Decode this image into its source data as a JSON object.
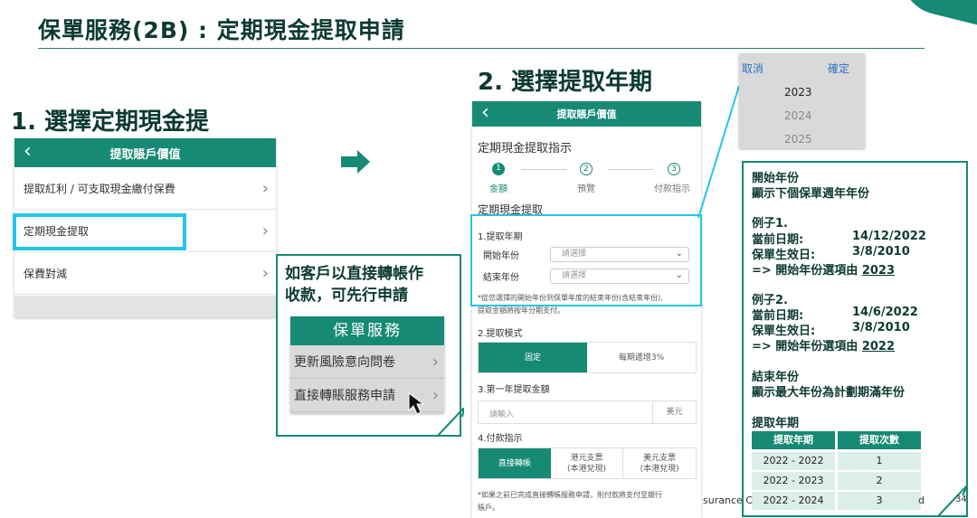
{
  "page": {
    "title": "保單服務(2B) : 定期現金提取申請",
    "page_number": "34",
    "footer_left": "surance C",
    "footer_right": "d"
  },
  "section1": {
    "title": "1. 選擇定期現金提"
  },
  "section2": {
    "title": "2. 選擇提取年期"
  },
  "panel1": {
    "header": "提取賬戶價值",
    "items": [
      {
        "label": "提取紅利 / 可支取現金繳付保費"
      },
      {
        "label": "定期現金提取"
      },
      {
        "label": "保費對減"
      }
    ]
  },
  "callout": {
    "text_line1": "如客戶以直接轉帳作",
    "text_line2": "收款，可先行申請",
    "mini_header": "保單服務",
    "mini_items": [
      {
        "label": "更新風險意向問卷"
      },
      {
        "label": "直接轉賬服務申請"
      }
    ]
  },
  "panel2": {
    "header": "提取賬戶價值",
    "section_title": "定期現金提取指示",
    "steps": [
      {
        "num": "1",
        "label": "金額"
      },
      {
        "num": "2",
        "label": "預覽"
      },
      {
        "num": "3",
        "label": "付款指示"
      }
    ],
    "subsection": "定期現金提取",
    "q1": "1.提取年期",
    "start_label": "開始年份",
    "end_label": "結束年份",
    "select_placeholder": "請選擇",
    "note1": "*從您選擇的開始年份到保單年度的結束年份(含結束年份),",
    "note2": "提取金額將按年分期支付。",
    "q2": "2.提取模式",
    "mode_options": [
      "固定",
      "每期遞增3%"
    ],
    "q3": "3.第一年提取金額",
    "amount_placeholder": "請輸入",
    "currency": "美元",
    "q4": "4.付款指示",
    "pay_options": [
      {
        "l1": "直接轉帳",
        "l2": ""
      },
      {
        "l1": "港元支票",
        "l2": "(本港兌現)"
      },
      {
        "l1": "美元支票",
        "l2": "(本港兌現)"
      }
    ],
    "note3": "*如果之前已完成直接轉賬服務申請，則付款將支付至銀行",
    "note4": "賬戶。"
  },
  "picker": {
    "cancel": "取消",
    "confirm": "確定",
    "years": [
      "2023",
      "2024",
      "2025"
    ]
  },
  "info": {
    "start_title": "開始年份",
    "start_desc": "顯示下個保單週年年份",
    "ex1_title": "例子1.",
    "ex1_date_label": "當前日期:",
    "ex1_date": "14/12/2022",
    "ex1_eff_label": "保單生效日:",
    "ex1_eff": "3/8/2010",
    "ex1_result": "=> 開始年份選項由",
    "ex1_year": "2023",
    "ex2_title": "例子2.",
    "ex2_date_label": "當前日期:",
    "ex2_date": "14/6/2022",
    "ex2_eff_label": "保單生效日:",
    "ex2_eff": "3/8/2010",
    "ex2_result": "=> 開始年份選項由",
    "ex2_year": "2022",
    "end_title": "結束年份",
    "end_desc": "顯示最大年份為計劃期滿年份",
    "period_title": "提取年期",
    "table": {
      "headers": [
        "提取年期",
        "提取次數"
      ],
      "rows": [
        [
          "2022 - 2022",
          "1"
        ],
        [
          "2022 - 2023",
          "2"
        ],
        [
          "2022 - 2024",
          "3"
        ]
      ]
    }
  }
}
